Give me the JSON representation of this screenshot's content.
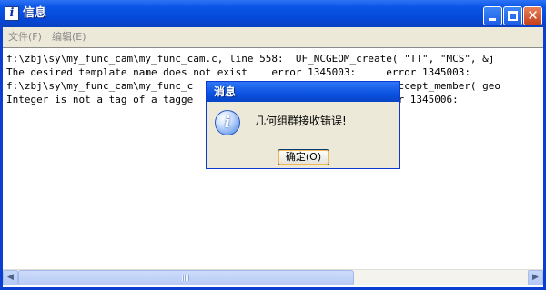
{
  "window": {
    "title": "信息",
    "icon": "i"
  },
  "menu": {
    "file": "文件(F)",
    "edit": "编辑(E)"
  },
  "content": {
    "lines": [
      "f:\\zbj\\sy\\my_func_cam\\my_func_cam.c, line 558:  UF_NCGEOM_create( \"TT\", \"MCS\", &j",
      "The desired template name does not exist    error 1345003:     error 1345003:",
      "f:\\zbj\\sy\\my_func_cam\\my_func_c                              an_accept_member( geo",
      "Integer is not a tag of a tagge                              error 1345006:"
    ]
  },
  "dialog": {
    "title": "消息",
    "icon": "i",
    "message": "几何组群接收错误!",
    "ok_label": "确定(O)"
  },
  "icons": {
    "app": "info-app-icon",
    "minimize": "minimize-icon",
    "maximize": "maximize-icon",
    "close": "close-icon",
    "dialog": "information-icon",
    "scroll_left": "arrow-left-icon",
    "scroll_right": "arrow-right-icon"
  },
  "colors": {
    "titlebar": "#0a56e6",
    "dialog_background": "#ece9d8",
    "close_button": "#c7401b"
  }
}
